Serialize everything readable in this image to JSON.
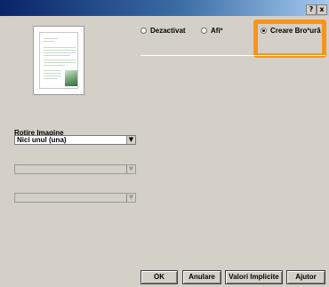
{
  "titlebar": {
    "help_label": "?",
    "close_label": "x"
  },
  "layout_options": {
    "selected": "booklet",
    "items": [
      {
        "label": "Dezactivat",
        "checked": false
      },
      {
        "label": "Afiº",
        "checked": false
      },
      {
        "label": "Creare Broºurã",
        "checked": true
      }
    ]
  },
  "highlight_color": "#f7941d",
  "rotation": {
    "label": "Rotire Imagine",
    "value": "Nici unul (una)"
  },
  "disabled_dropdowns": [
    {
      "value": ""
    },
    {
      "value": ""
    }
  ],
  "buttons": {
    "ok": "OK",
    "cancel": "Anulare",
    "defaults": "Valori Implicite",
    "help": "Ajutor"
  }
}
